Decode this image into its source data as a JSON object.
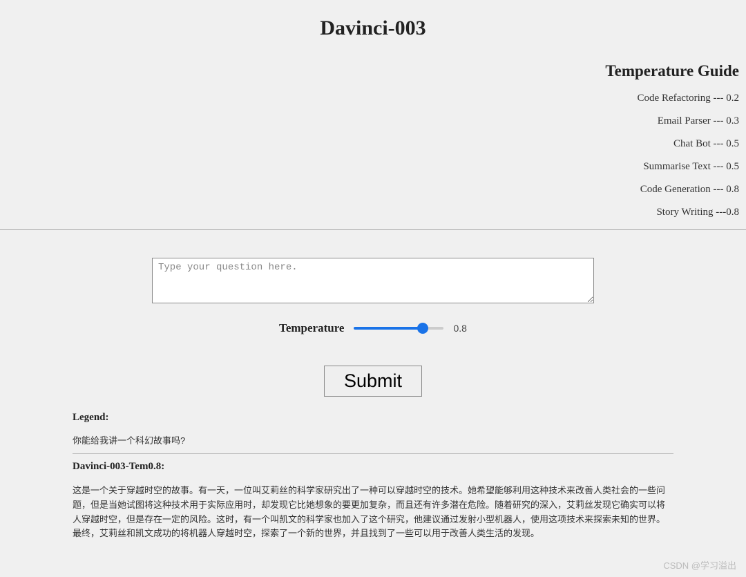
{
  "title": "Davinci-003",
  "guide": {
    "title": "Temperature Guide",
    "items": [
      "Code Refactoring --- 0.2",
      "Email Parser --- 0.3",
      "Chat Bot --- 0.5",
      "Summarise Text --- 0.5",
      "Code Generation --- 0.8",
      "Story Writing ---0.8"
    ]
  },
  "form": {
    "placeholder": "Type your question here.",
    "temperature_label": "Temperature",
    "temperature_value": "0.8",
    "slider_min": "0",
    "slider_max": "1",
    "slider_step": "0.1",
    "slider_value": "0.8",
    "submit_label": "Submit"
  },
  "results": {
    "legend_label": "Legend:",
    "legend_question": "你能给我讲一个科幻故事吗?",
    "response_label": "Davinci-003-Tem0.8:",
    "response_body": "这是一个关于穿越时空的故事。有一天，一位叫艾莉丝的科学家研究出了一种可以穿越时空的技术。她希望能够利用这种技术来改善人类社会的一些问题，但是当她试图将这种技术用于实际应用时，却发现它比她想象的要更加复杂，而且还有许多潜在危险。随着研究的深入，艾莉丝发现它确实可以将人穿越时空，但是存在一定的风险。这时，有一个叫凯文的科学家也加入了这个研究，他建议通过发射小型机器人，使用这项技术来探索未知的世界。最终，艾莉丝和凯文成功的将机器人穿越时空，探索了一个新的世界，并且找到了一些可以用于改善人类生活的发现。"
  },
  "watermark": "CSDN @学习溢出"
}
